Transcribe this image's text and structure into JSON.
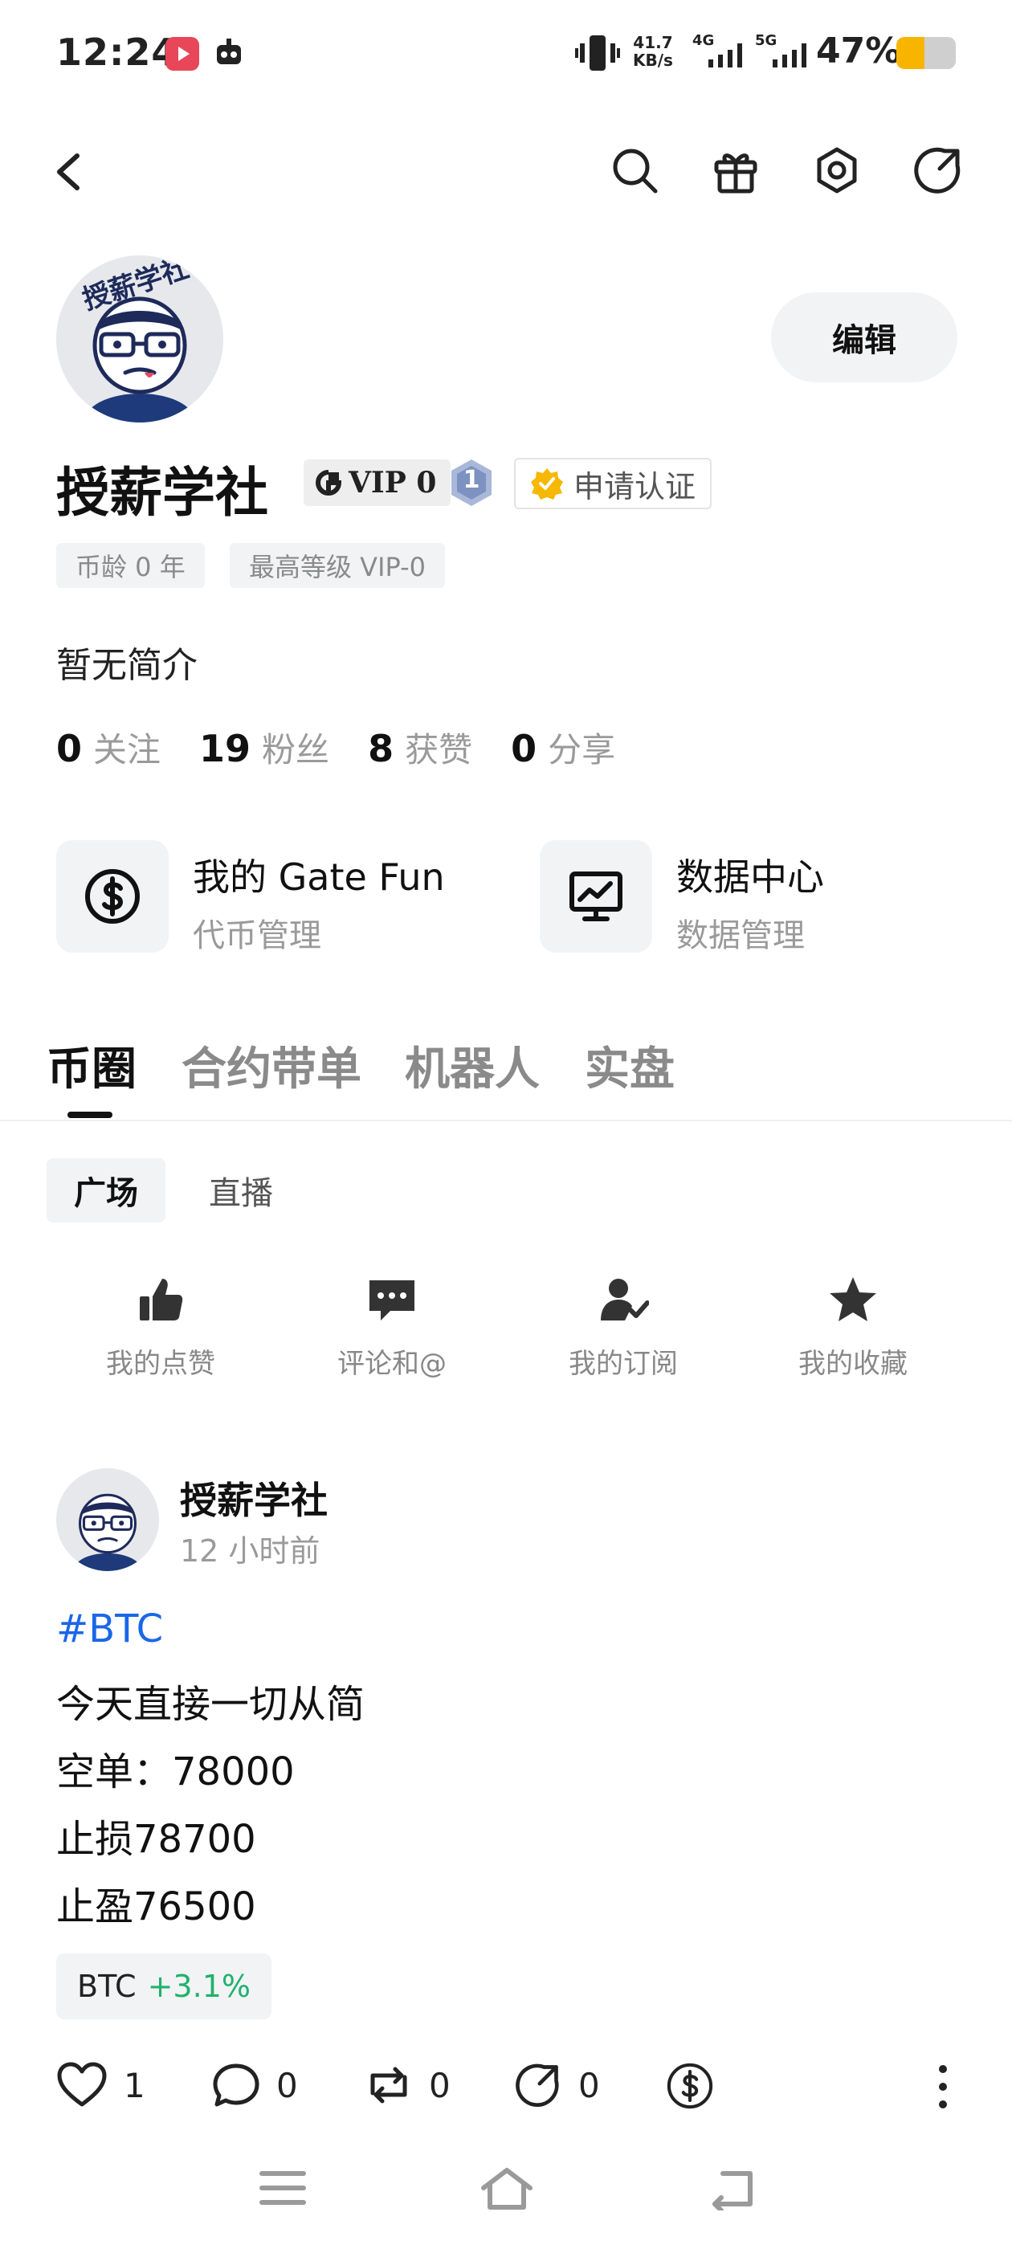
{
  "status_bar": {
    "time": "12:24",
    "net_speed": "41.7",
    "net_unit": "KB/s",
    "net_4g": "4G",
    "net_5g": "5G",
    "battery_percent": "47%",
    "battery_level": 0.47,
    "battery_color": "#f7b500"
  },
  "header": {
    "back_icon": "back-arrow-icon",
    "actions": [
      "search-icon",
      "gift-icon",
      "settings-icon",
      "share-icon"
    ]
  },
  "profile": {
    "avatar_text": "授薪学社",
    "edit_label": "编辑",
    "name": "授薪学社",
    "vip_label": "VIP 0",
    "level_badge": "1",
    "verify_label": "申请认证",
    "chips": [
      "币龄 0 年",
      "最高等级 VIP-0"
    ],
    "bio": "暂无简介",
    "stats": [
      {
        "count": "0",
        "label": "关注"
      },
      {
        "count": "19",
        "label": "粉丝"
      },
      {
        "count": "8",
        "label": "获赞"
      },
      {
        "count": "0",
        "label": "分享"
      }
    ]
  },
  "feature_cards": [
    {
      "title": "我的 Gate Fun",
      "subtitle": "代币管理",
      "icon": "dollar-coin-icon"
    },
    {
      "title": "数据中心",
      "subtitle": "数据管理",
      "icon": "chart-monitor-icon"
    }
  ],
  "tabs": [
    "币圈",
    "合约带单",
    "机器人",
    "实盘"
  ],
  "active_tab": "币圈",
  "sub_tabs": [
    "广场",
    "直播"
  ],
  "active_sub_tab": "广场",
  "quick_actions": [
    {
      "label": "我的点赞",
      "icon": "thumbs-up-icon"
    },
    {
      "label": "评论和@",
      "icon": "comment-icon"
    },
    {
      "label": "我的订阅",
      "icon": "subscribe-icon"
    },
    {
      "label": "我的收藏",
      "icon": "star-icon"
    }
  ],
  "post": {
    "author": "授薪学社",
    "time": "12 小时前",
    "hashtag": "#BTC",
    "lines": [
      "今天直接一切从简",
      "空单：78000",
      "止损78700",
      "止盈76500"
    ],
    "coin_symbol": "BTC",
    "coin_change": "+3.1%",
    "coin_change_color": "#20b26c",
    "likes": "1",
    "comments": "0",
    "reposts": "0",
    "shares": "0"
  },
  "nav_bar": [
    "menu-icon",
    "home-icon",
    "back-icon"
  ]
}
